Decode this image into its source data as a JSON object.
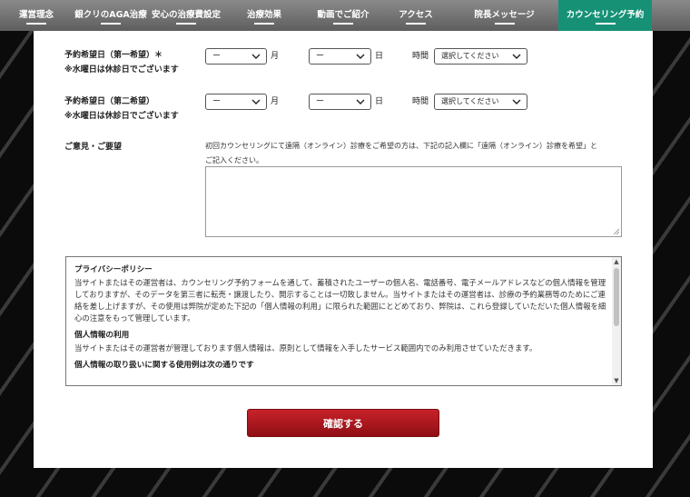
{
  "nav": {
    "items": [
      {
        "label": "運営理念"
      },
      {
        "label": "銀クリのAGA治療"
      },
      {
        "label": "安心の治療費設定"
      },
      {
        "label": "治療効果"
      },
      {
        "label": "動画でご紹介"
      },
      {
        "label": "アクセス"
      },
      {
        "label": "院長メッセージ"
      },
      {
        "label": "カウンセリング予約"
      }
    ],
    "active_color": "#179176"
  },
  "form": {
    "first": {
      "label": "予約希望日（第一希望）＊",
      "note": "※水曜日は休診日でございます",
      "month_value": "ー",
      "month_unit": "月",
      "day_value": "ー",
      "day_unit": "日",
      "time_label": "時間",
      "time_value": "選択してください"
    },
    "second": {
      "label": "予約希望日（第二希望）",
      "note": "※水曜日は休診日でございます",
      "month_value": "ー",
      "month_unit": "月",
      "day_value": "ー",
      "day_unit": "日",
      "time_label": "時間",
      "time_value": "選択してください"
    },
    "opinion": {
      "label": "ご意見・ご要望",
      "note_line1": "初回カウンセリングにて遠隔（オンライン）診療をご希望の方は、下記の記入欄に「遠隔（オンライン）診療を希望」と",
      "note_line2": "ご記入ください。",
      "value": ""
    }
  },
  "privacy": {
    "title": "プライバシーポリシー",
    "body1": "当サイトまたはその運営者は、カウンセリング予約フォームを通して、蓄積されたユーザーの個人名、電話番号、電子メールアドレスなどの個人情報を管理しておりますが、そのデータを第三者に転売・譲渡したり、開示することは一切致しません。当サイトまたはその運営者は、診療の予約業務等のためにご連絡を差し上げますが、その使用は弊院が定めた下記の「個人情報の利用」に限られた範囲にとどめており、弊院は、これら登録していただいた個人情報を細心の注意をもって管理しています。",
    "heading2": "個人情報の利用",
    "body2": "当サイトまたはその運営者が管理しております個人情報は、原則として情報を入手したサービス範囲内でのみ利用させていただきます。",
    "heading3": "個人情報の取り扱いに関する使用例は次の通りです"
  },
  "submit": {
    "label": "確認する",
    "color": "#b51b22"
  }
}
